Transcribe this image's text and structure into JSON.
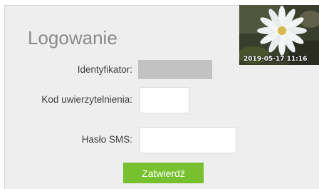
{
  "login": {
    "title": "Logowanie",
    "identifier_label": "Identyfikator:",
    "identifier_value": "",
    "auth_code_label": "Kod uwierzytelnienia:",
    "auth_code_value": "",
    "sms_password_label": "Hasło SMS:",
    "sms_password_value": "",
    "submit_label": "Zatwierdź"
  },
  "auth_image": {
    "timestamp": "2019-05-17 11:16"
  },
  "colors": {
    "panel_background": "#eeeeee",
    "button_accent": "#77c12f",
    "disabled_field": "#c2c2c2"
  }
}
